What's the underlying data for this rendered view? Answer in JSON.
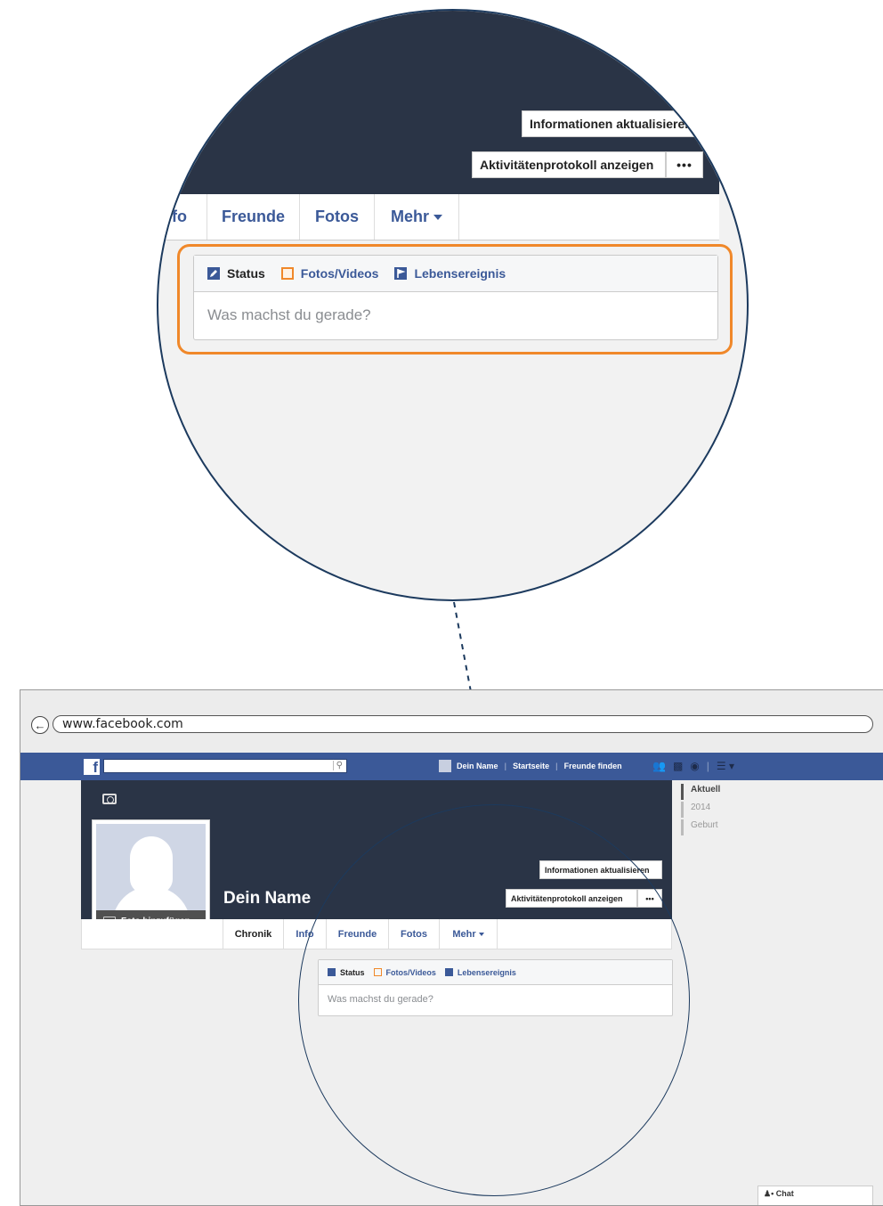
{
  "zoom": {
    "buttons": {
      "update_info": "Informationen aktualisieren",
      "activity_log": "Aktivitätenprotokoll anzeigen",
      "more": "•••"
    },
    "tabs": {
      "info_partial": "fo",
      "friends": "Freunde",
      "photos": "Fotos",
      "more": "Mehr"
    },
    "composer": {
      "status": "Status",
      "photos_videos": "Fotos/Videos",
      "life_event": "Lebensereignis",
      "placeholder": "Was machst du gerade?"
    },
    "highlight_color": "#f0882a"
  },
  "browser": {
    "url": "www.facebook.com",
    "back_icon": "back-arrow-icon"
  },
  "fb": {
    "logo": "f",
    "nav": {
      "user_name": "Dein Name",
      "home": "Startseite",
      "find_friends": "Freunde finden"
    },
    "icons": [
      "friends-icon",
      "messages-icon",
      "notifications-icon",
      "settings-icon"
    ],
    "brand_color": "#3b5998"
  },
  "profile": {
    "name": "Dein Name",
    "add_photo": "Foto hinzufügen",
    "update_info": "Informationen aktualisieren",
    "activity_log": "Aktivitätenprotokoll anzeigen",
    "more": "•••",
    "tabs": {
      "chronik": "Chronik",
      "info": "Info",
      "friends": "Freunde",
      "photos": "Fotos",
      "more": "Mehr"
    },
    "composer": {
      "status": "Status",
      "photos_videos": "Fotos/Videos",
      "life_event": "Lebensereignis",
      "placeholder": "Was machst du gerade?"
    }
  },
  "timeline": {
    "items": [
      "Aktuell",
      "2014",
      "Geburt"
    ]
  },
  "chat": {
    "label": "Chat"
  }
}
